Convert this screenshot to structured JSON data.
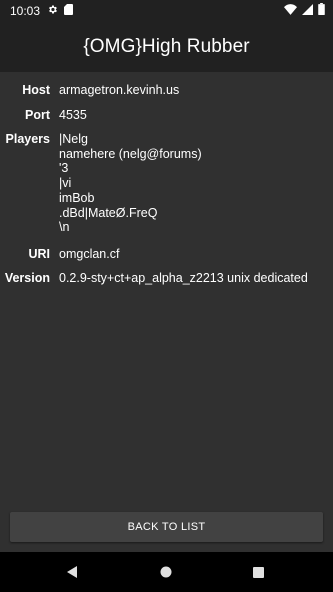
{
  "status_bar": {
    "time": "10:03",
    "left_icons": [
      "gear-icon",
      "sd-card-icon"
    ],
    "right_icons": [
      "wifi-icon",
      "signal-icon",
      "battery-icon"
    ]
  },
  "app_bar": {
    "title": "{OMG}High Rubber"
  },
  "server": {
    "host_label": "Host",
    "host_value": "armagetron.kevinh.us",
    "port_label": "Port",
    "port_value": "4535",
    "players_label": "Players",
    "players": [
      "|Nelg",
      "namehere (nelg@forums)",
      "'3",
      "|vi",
      "imBob",
      ".dBd|MateØ.FreQ",
      "\\n"
    ],
    "uri_label": "URI",
    "uri_value": "omgclan.cf",
    "version_label": "Version",
    "version_value": "0.2.9-sty+ct+ap_alpha_z2213 unix dedicated"
  },
  "actions": {
    "back_label": "BACK TO LIST"
  },
  "nav_bar": {
    "buttons": [
      "back-icon",
      "home-icon",
      "recents-icon"
    ]
  },
  "colors": {
    "app_bar": "#212121",
    "background": "#303030",
    "button": "#424242",
    "nav_bar": "#000000"
  }
}
